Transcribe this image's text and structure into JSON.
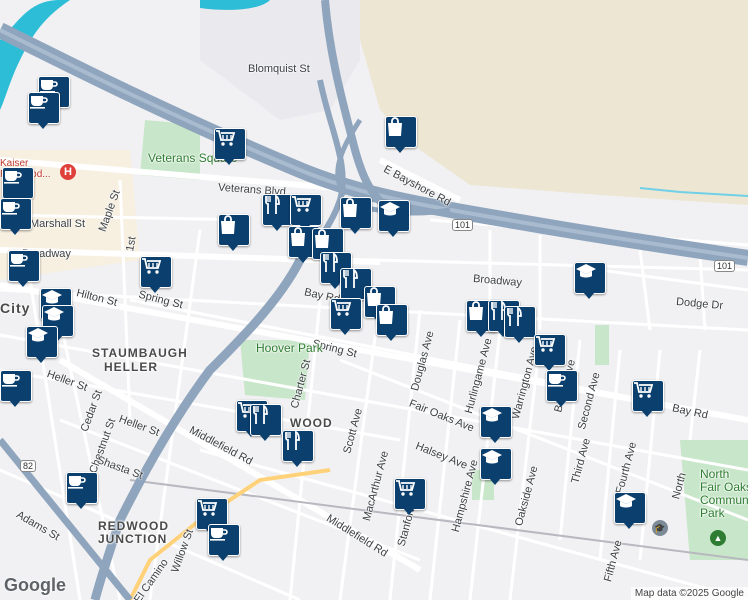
{
  "map": {
    "labels": {
      "blomquist": "Blomquist St",
      "veterans_square": "Veterans Square",
      "veterans_blvd": "Veterans Blvd",
      "e_bayshore": "E Bayshore Rd",
      "marshall": "Marshall St",
      "maple": "Maple St",
      "broadway_w": "Broadway",
      "broadway_e": "Broadway",
      "dodge": "Dodge Dr",
      "hilton": "Hilton St",
      "spring_w": "Spring St",
      "spring_e": "Spring St",
      "bay_rd_w": "Bay Rd",
      "bay_rd_e": "Bay Rd",
      "staumbaugh": "STAUMBAUGH",
      "heller_area": "HELLER",
      "heller_st": "Heller St",
      "heller_st2": "Heller St",
      "hoover_park": "Hoover Park",
      "charter": "Charter St",
      "douglas": "Douglas Ave",
      "hurlingame": "Hurlingame Ave",
      "warrington": "Warrington Ave",
      "barron": "Barron Ave",
      "second": "Second Ave",
      "third": "Third Ave",
      "fourth": "Fourth Ave",
      "fifth": "Fifth Ave",
      "fair_oaks": "Fair Oaks Ave",
      "halsey": "Halsey Ave",
      "hampshire": "Hampshire Ave",
      "oakside": "Oakside Ave",
      "scott": "Scott Ave",
      "macarthur": "MacArthur Ave",
      "middlefield_w": "Middlefield Rd",
      "middlefield_e": "Middlefield Rd",
      "cedar": "Cedar St",
      "chestnut": "Chestnut St",
      "shasta": "Shasta St",
      "adams": "Adams St",
      "willow": "Willow St",
      "redwood_junction": "REDWOOD\nJUNCTION",
      "el_camino": "El Camino",
      "north_fair_oaks": "North\nFair Oaks\nCommunity\nPark",
      "city": "City",
      "wood": "WOOD",
      "hospital": "Kaiser\nRedwood...",
      "st_1": "1st",
      "stanford": "Stanford",
      "north": "North"
    },
    "shields": {
      "us101_a": "101",
      "us101_b": "101",
      "ca82": "82"
    },
    "markers": [
      {
        "type": "cafe",
        "icon": "cafe-icon"
      },
      {
        "type": "cafe",
        "icon": "cafe-icon"
      },
      {
        "type": "grocery",
        "icon": "cart-icon"
      },
      {
        "type": "shopping",
        "icon": "bag-icon"
      },
      {
        "type": "cafe",
        "icon": "cafe-icon"
      },
      {
        "type": "cafe",
        "icon": "cafe-icon"
      },
      {
        "type": "restaurant",
        "icon": "fork-knife-icon"
      },
      {
        "type": "grocery",
        "icon": "cart-icon"
      },
      {
        "type": "shopping",
        "icon": "bag-icon"
      },
      {
        "type": "school",
        "icon": "school-icon"
      },
      {
        "type": "shopping",
        "icon": "bag-icon"
      },
      {
        "type": "shopping",
        "icon": "bag-icon"
      },
      {
        "type": "shopping",
        "icon": "bag-icon"
      },
      {
        "type": "cafe",
        "icon": "cafe-icon"
      },
      {
        "type": "grocery",
        "icon": "cart-icon"
      },
      {
        "type": "restaurant",
        "icon": "fork-knife-icon"
      },
      {
        "type": "restaurant",
        "icon": "fork-knife-icon"
      },
      {
        "type": "school",
        "icon": "school-icon"
      },
      {
        "type": "school",
        "icon": "school-icon"
      },
      {
        "type": "shopping",
        "icon": "bag-icon"
      },
      {
        "type": "grocery",
        "icon": "cart-icon"
      },
      {
        "type": "shopping",
        "icon": "bag-icon"
      },
      {
        "type": "school",
        "icon": "school-icon"
      },
      {
        "type": "shopping",
        "icon": "bag-icon"
      },
      {
        "type": "restaurant",
        "icon": "fork-knife-icon"
      },
      {
        "type": "restaurant",
        "icon": "fork-knife-icon"
      },
      {
        "type": "grocery",
        "icon": "cart-icon"
      },
      {
        "type": "cafe",
        "icon": "cafe-icon"
      },
      {
        "type": "grocery",
        "icon": "cart-icon"
      },
      {
        "type": "school",
        "icon": "school-icon"
      },
      {
        "type": "grocery",
        "icon": "cart-icon"
      },
      {
        "type": "restaurant",
        "icon": "fork-knife-icon"
      },
      {
        "type": "restaurant",
        "icon": "fork-knife-icon"
      },
      {
        "type": "school",
        "icon": "school-icon"
      },
      {
        "type": "school",
        "icon": "school-icon"
      },
      {
        "type": "grocery",
        "icon": "cart-icon"
      },
      {
        "type": "cafe",
        "icon": "cafe-icon"
      },
      {
        "type": "grocery",
        "icon": "cart-icon"
      },
      {
        "type": "cafe",
        "icon": "cafe-icon"
      },
      {
        "type": "school",
        "icon": "school-icon"
      },
      {
        "type": "cafe",
        "icon": "cafe-icon"
      }
    ],
    "colors": {
      "marker": "#0b3f6e",
      "freeway": "#8fa5bd",
      "park": "#c8e6c9",
      "water": "#2dbdd6",
      "wetland": "#ece6d3",
      "hospital": "#e0403a"
    }
  },
  "branding": {
    "logo_text": "Google"
  },
  "attribution": {
    "text": "Map data ©2025 Google"
  }
}
